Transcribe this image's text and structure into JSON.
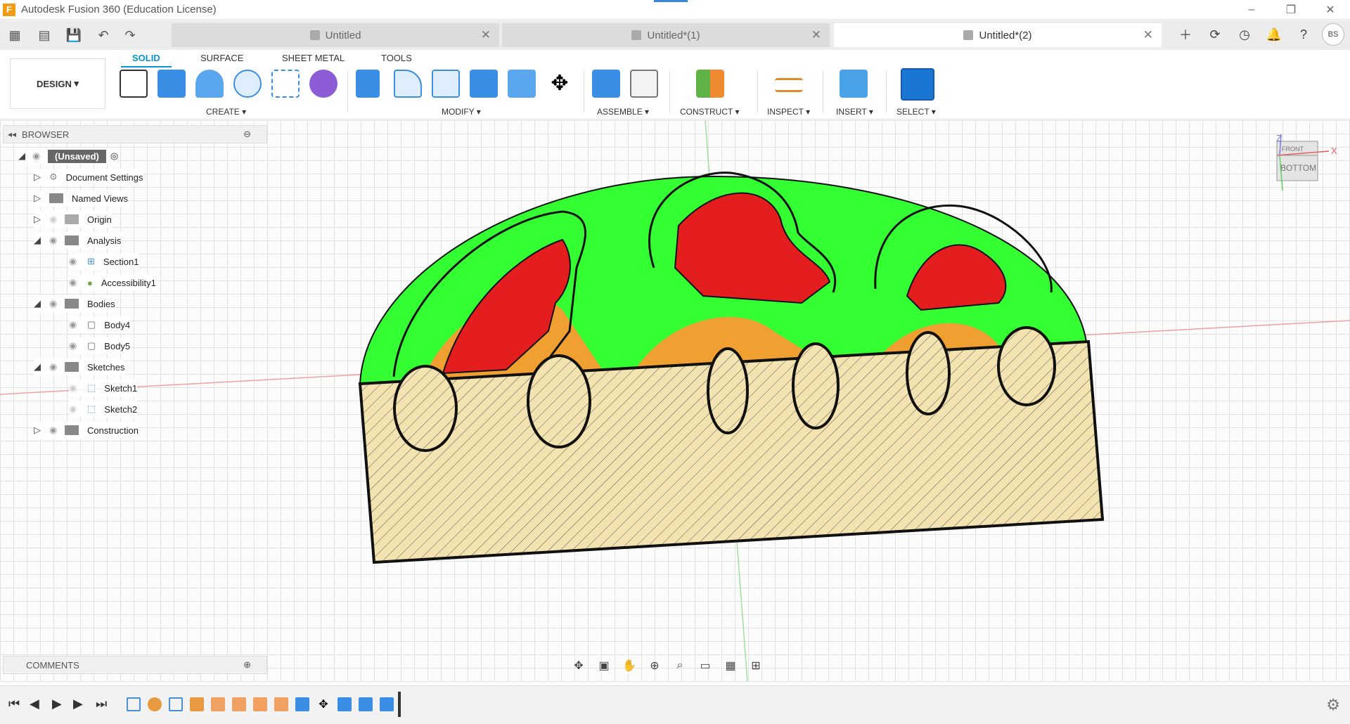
{
  "app": {
    "title": "Autodesk Fusion 360 (Education License)"
  },
  "tabs": [
    {
      "label": "Untitled",
      "active": false
    },
    {
      "label": "Untitled*(1)",
      "active": false
    },
    {
      "label": "Untitled*(2)",
      "active": true
    }
  ],
  "user": {
    "initials": "BS"
  },
  "workspace": {
    "label": "DESIGN"
  },
  "mode_tabs": [
    "SOLID",
    "SURFACE",
    "SHEET METAL",
    "TOOLS"
  ],
  "groups": {
    "create": "CREATE",
    "modify": "MODIFY",
    "assemble": "ASSEMBLE",
    "construct": "CONSTRUCT",
    "inspect": "INSPECT",
    "insert": "INSERT",
    "select": "SELECT"
  },
  "browser": {
    "title": "BROWSER",
    "root": "(Unsaved)",
    "items": [
      {
        "label": "Document Settings"
      },
      {
        "label": "Named Views"
      },
      {
        "label": "Origin"
      },
      {
        "label": "Analysis"
      },
      {
        "label": "Section1"
      },
      {
        "label": "Accessibility1"
      },
      {
        "label": "Bodies"
      },
      {
        "label": "Body4"
      },
      {
        "label": "Body5"
      },
      {
        "label": "Sketches"
      },
      {
        "label": "Sketch1"
      },
      {
        "label": "Sketch2"
      },
      {
        "label": "Construction"
      }
    ]
  },
  "comments": {
    "title": "COMMENTS"
  },
  "viewcube": {
    "front": "FRONT",
    "bottom": "BOTTOM",
    "axis_x": "X",
    "axis_z": "Z"
  },
  "colors": {
    "accent": "#0696d7",
    "green": "#33ff33",
    "red": "#e41e1e",
    "orange": "#f0a030",
    "section_fill": "#f3e3b0"
  }
}
